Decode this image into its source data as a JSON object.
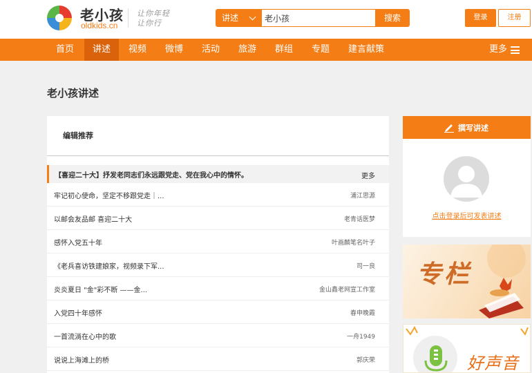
{
  "header": {
    "logo_text": "老小孩",
    "logo_domain": "oldkids.cn",
    "slogan_line1": "让你年轻",
    "slogan_line2": "让你行"
  },
  "search": {
    "category": "讲述",
    "value": "老小孩",
    "button": "搜索"
  },
  "auth": {
    "login": "登录",
    "register": "注册"
  },
  "nav": {
    "items": [
      "首页",
      "讲述",
      "视频",
      "微博",
      "活动",
      "旅游",
      "群组",
      "专题",
      "建言献策"
    ],
    "active": "讲述",
    "more": "更多"
  },
  "page": {
    "title": "老小孩讲述"
  },
  "panel": {
    "heading": "编辑推荐",
    "featured": {
      "title": "【喜迎二十大】抒发老同志们永远跟党走、党在我心中的情怀。",
      "more": "更多"
    },
    "rows": [
      {
        "title": "牢记初心使命，坚定不移跟党走｜...",
        "author": "浦江思源"
      },
      {
        "title": "以邮会友品邮 喜迎二十大",
        "author": "老青话医梦"
      },
      {
        "title": "感怀入党五十年",
        "author": "叶画麟笔名叶子"
      },
      {
        "title": "《老兵喜访铁建娘家，视频录下军...",
        "author": "司一良"
      },
      {
        "title": "炎炎夏日 \"金\"彩不断 ——金...",
        "author": "金山鑫老网宣工作室"
      },
      {
        "title": "入党四十年感怀",
        "author": "春申晚霞"
      },
      {
        "title": "一首流淌在心中的歌",
        "author": "一舟1949"
      },
      {
        "title": "说说上海滩上的桥",
        "author": "郭庆荣"
      }
    ]
  },
  "sidebar": {
    "write_button": "撰写讲述",
    "login_prompt": "点击登录后可发表讲述",
    "banner1_text": "专栏",
    "banner2_text": "好声音"
  },
  "colors": {
    "brand": "#f47d16",
    "nav_active": "#d9620a"
  }
}
